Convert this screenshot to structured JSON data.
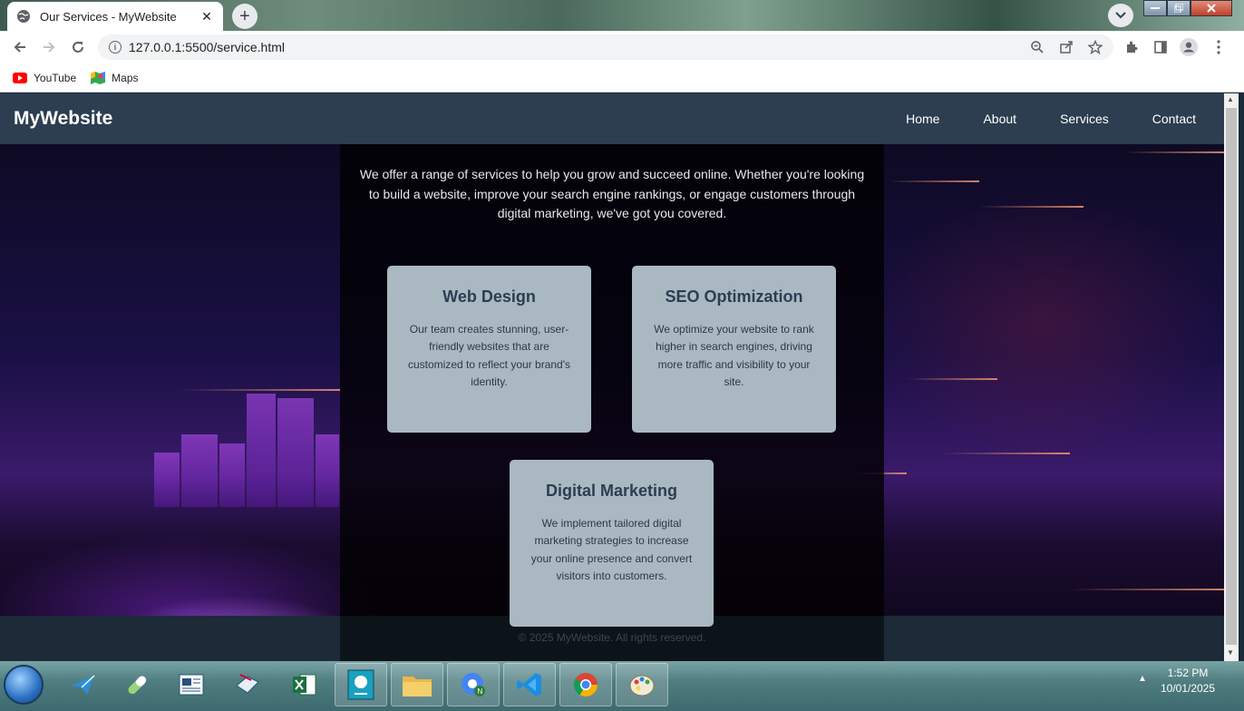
{
  "browser": {
    "tab_title": "Our Services - MyWebsite",
    "tab_close": "✕",
    "new_tab": "+",
    "url": "127.0.0.1:5500/service.html",
    "bookmarks": [
      {
        "label": "YouTube",
        "icon": "youtube-icon"
      },
      {
        "label": "Maps",
        "icon": "maps-icon"
      }
    ]
  },
  "site": {
    "logo": "MyWebsite",
    "nav": [
      "Home",
      "About",
      "Services",
      "Contact"
    ],
    "intro": "We offer a range of services to help you grow and succeed online. Whether you're looking to build a website, improve your search engine rankings, or engage customers through digital marketing, we've got you covered.",
    "services": [
      {
        "title": "Web Design",
        "description": "Our team creates stunning, user-friendly websites that are customized to reflect your brand's identity."
      },
      {
        "title": "SEO Optimization",
        "description": "We optimize your website to rank higher in search engines, driving more traffic and visibility to your site."
      },
      {
        "title": "Digital Marketing",
        "description": "We implement tailored digital marketing strategies to increase your online presence and convert visitors into customers."
      }
    ],
    "footer": "© 2025 MyWebsite. All rights reserved."
  },
  "taskbar": {
    "time": "1:52 PM",
    "date": "10/01/2025",
    "apps": [
      "paper-plane-icon",
      "pill-icon",
      "document-icon",
      "scanner-icon",
      "excel-icon",
      "bookmark-app-icon",
      "file-explorer-icon",
      "chrome-profile-icon",
      "vscode-icon",
      "chrome-icon",
      "paint-icon"
    ]
  },
  "colors": {
    "header": "#2c3e50",
    "card": "#aab8c2",
    "card_title": "#2c3e50"
  }
}
